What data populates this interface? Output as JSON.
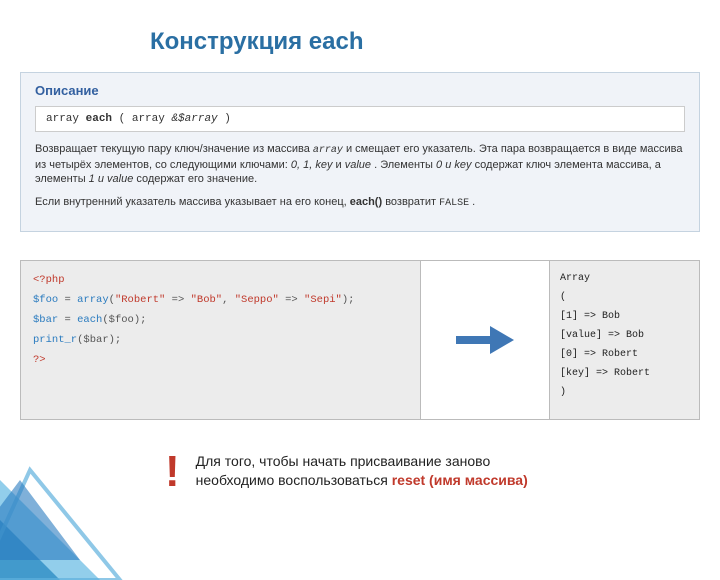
{
  "title": "Конструкция each",
  "description": {
    "heading": "Описание",
    "sig_return": "array",
    "sig_fn": "each",
    "sig_paren_open": " ( array ",
    "sig_param": "&$array",
    "sig_paren_close": " )",
    "p1_a": "Возвращает текущую пару ключ/значение из массива ",
    "p1_arr": "array",
    "p1_b": " и смещает его указатель. Эта пара возвращается в виде массива из четырёх элементов, со следующими ключами: ",
    "p1_keys": "0, 1, key",
    "p1_c": " и ",
    "p1_val": "value",
    "p1_d": ". Элементы ",
    "p1_0key": "0 и key",
    "p1_e": " содержат ключ элемента массива, а элементы ",
    "p1_1val": "1 и value",
    "p1_f": " содержат его значение.",
    "p2_a": "Если внутренний указатель массива указывает на его конец, ",
    "p2_fn": "each()",
    "p2_b": " возвратит ",
    "p2_false": "FALSE",
    "p2_c": "."
  },
  "code": {
    "l1": "<?php",
    "l2_var": "$foo",
    "l2_eq": " = ",
    "l2_arr": "array",
    "l2_open": "(",
    "l2_k1": "\"Robert\"",
    "l2_ar1": " => ",
    "l2_v1": "\"Bob\"",
    "l2_sep": ", ",
    "l2_k2": "\"Seppo\"",
    "l2_ar2": " => ",
    "l2_v2": "\"Sepi\"",
    "l2_close": ");",
    "l3_var": "$bar",
    "l3_eq": " = ",
    "l3_fn": "each",
    "l3_arg": "($foo);",
    "l4_fn": "print_r",
    "l4_arg": "($bar);",
    "l5": "?>"
  },
  "output": {
    "r1": "Array",
    "r2": "(",
    "r3": "    [1] => Bob",
    "r4": "    [value] => Bob",
    "r5": "    [0] => Robert",
    "r6": "    [key] => Robert",
    "r7": ")"
  },
  "tip": {
    "bang": "!",
    "line1": "Для того, чтобы начать присваивание заново",
    "line2_a": "необходимо воспользоваться ",
    "line2_b": "reset (имя массива)"
  },
  "colors": {
    "accent_blue": "#2a6fa3",
    "arrow_blue": "#3f77b5",
    "warn_red": "#c0392b"
  }
}
